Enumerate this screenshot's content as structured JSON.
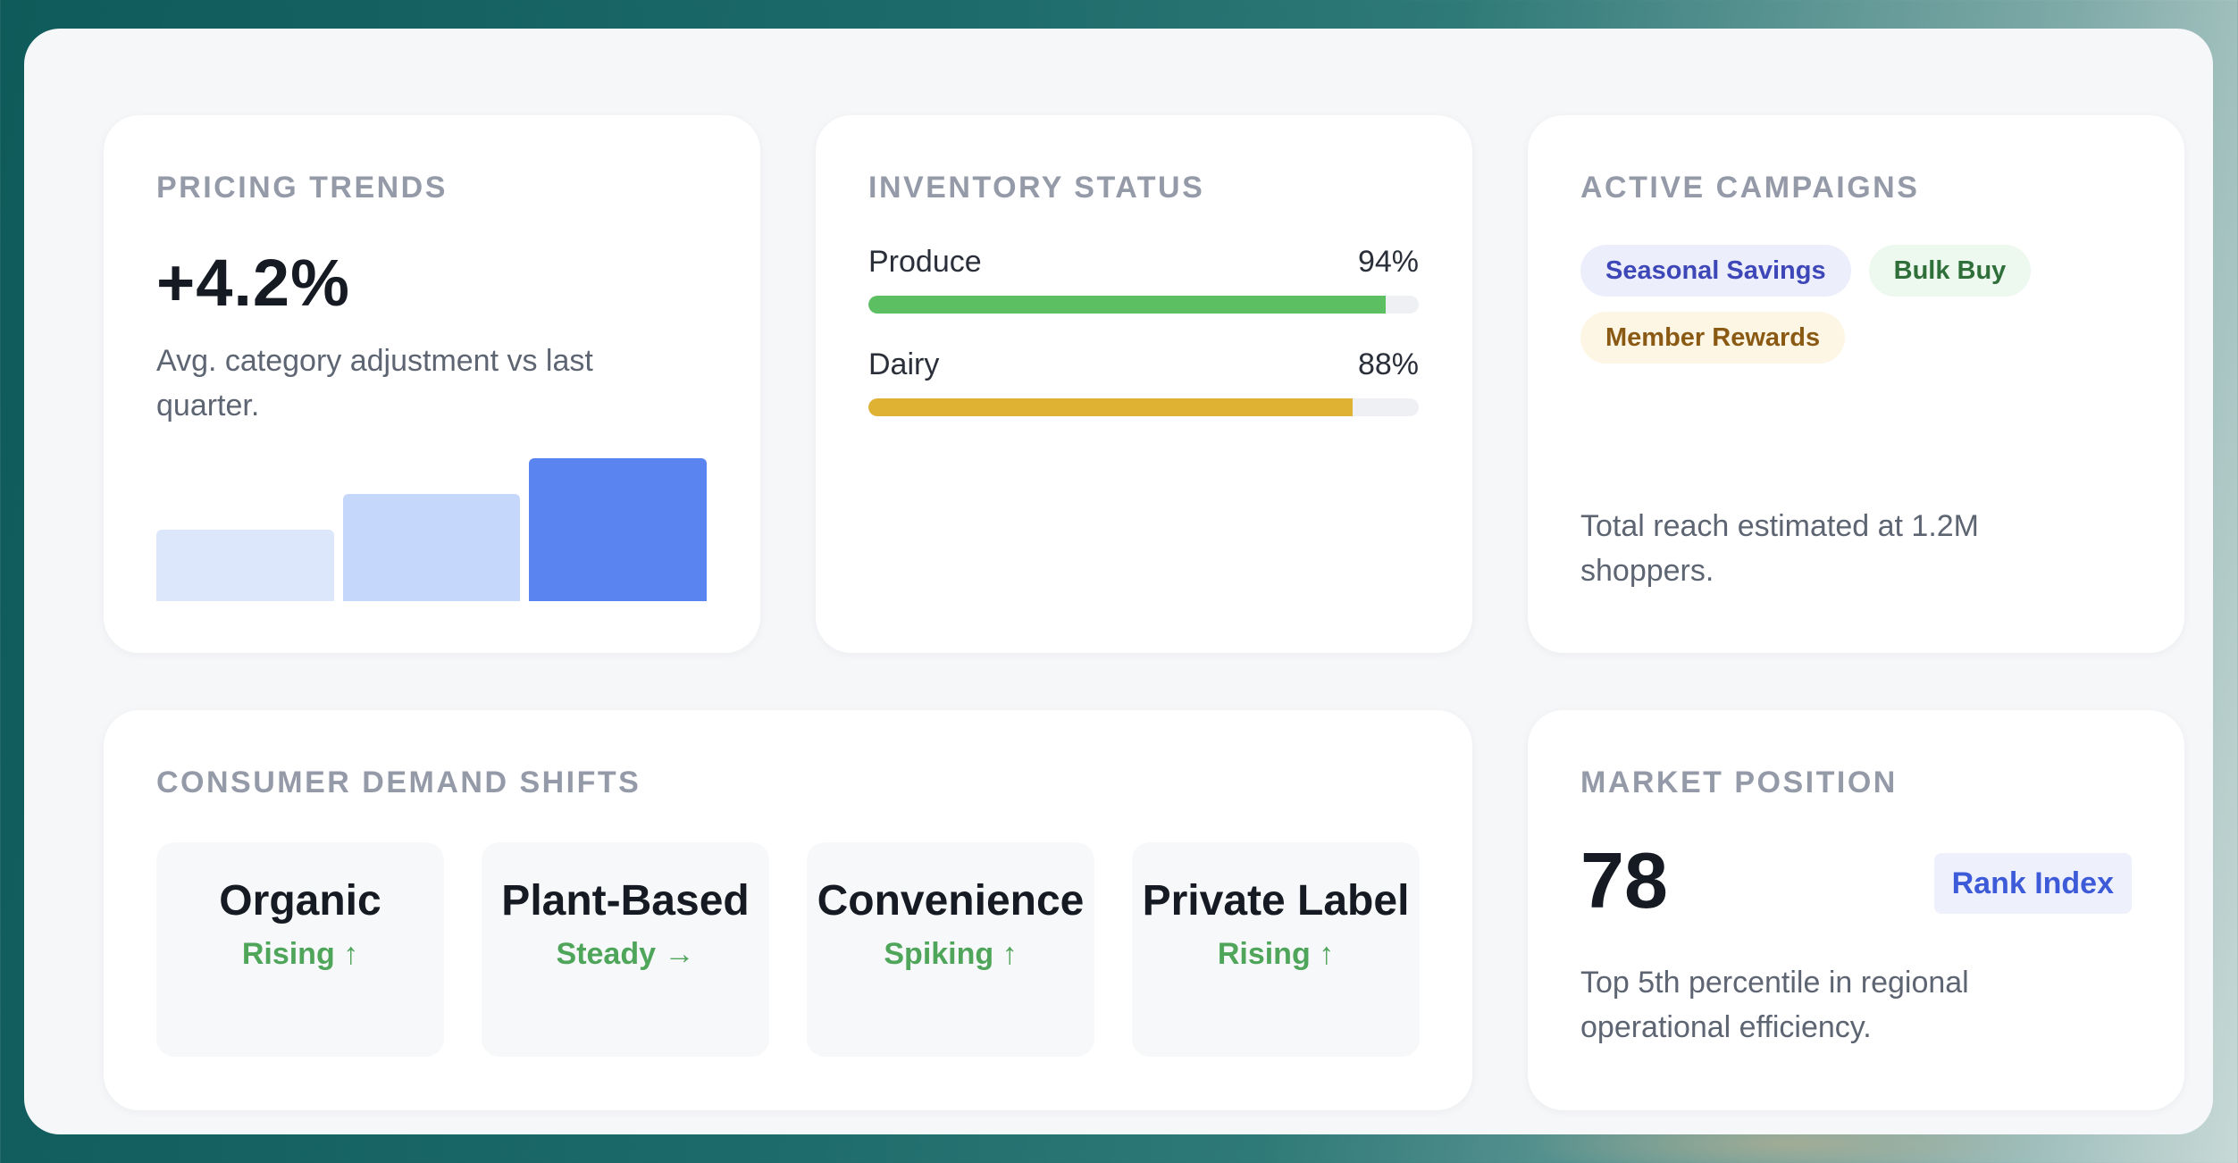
{
  "pricing": {
    "title": "PRICING TRENDS",
    "value": "+4.2%",
    "description": "Avg. category adjustment vs last quarter.",
    "bars": [
      {
        "level": 0.5,
        "color": "#dce7fb"
      },
      {
        "level": 0.75,
        "color": "#c5d7fa"
      },
      {
        "level": 1.0,
        "color": "#5a84ef"
      }
    ]
  },
  "inventory": {
    "title": "INVENTORY STATUS",
    "items": [
      {
        "label": "Produce",
        "value": "94%",
        "percent": 94,
        "color": "#5cbf62"
      },
      {
        "label": "Dairy",
        "value": "88%",
        "percent": 88,
        "color": "#dfb234"
      }
    ]
  },
  "campaigns": {
    "title": "ACTIVE CAMPAIGNS",
    "chips": [
      {
        "label": "Seasonal Savings",
        "bg": "#eceefc",
        "fg": "#3e47b8"
      },
      {
        "label": "Bulk Buy",
        "bg": "#edf8ee",
        "fg": "#2f6f3a"
      },
      {
        "label": "Member Rewards",
        "bg": "#fdf6e5",
        "fg": "#8a5a14"
      }
    ],
    "description": "Total reach estimated at 1.2M shoppers."
  },
  "demand": {
    "title": "CONSUMER DEMAND SHIFTS",
    "tiles": [
      {
        "name": "Organic",
        "status": "Rising ↑"
      },
      {
        "name": "Plant-Based",
        "status": "Steady →"
      },
      {
        "name": "Convenience",
        "status": "Spiking ↑"
      },
      {
        "name": "Private Label",
        "status": "Rising ↑"
      }
    ]
  },
  "market": {
    "title": "MARKET POSITION",
    "value": "78",
    "badge": "Rank Index",
    "description": "Top 5th percentile in regional operational efficiency."
  }
}
